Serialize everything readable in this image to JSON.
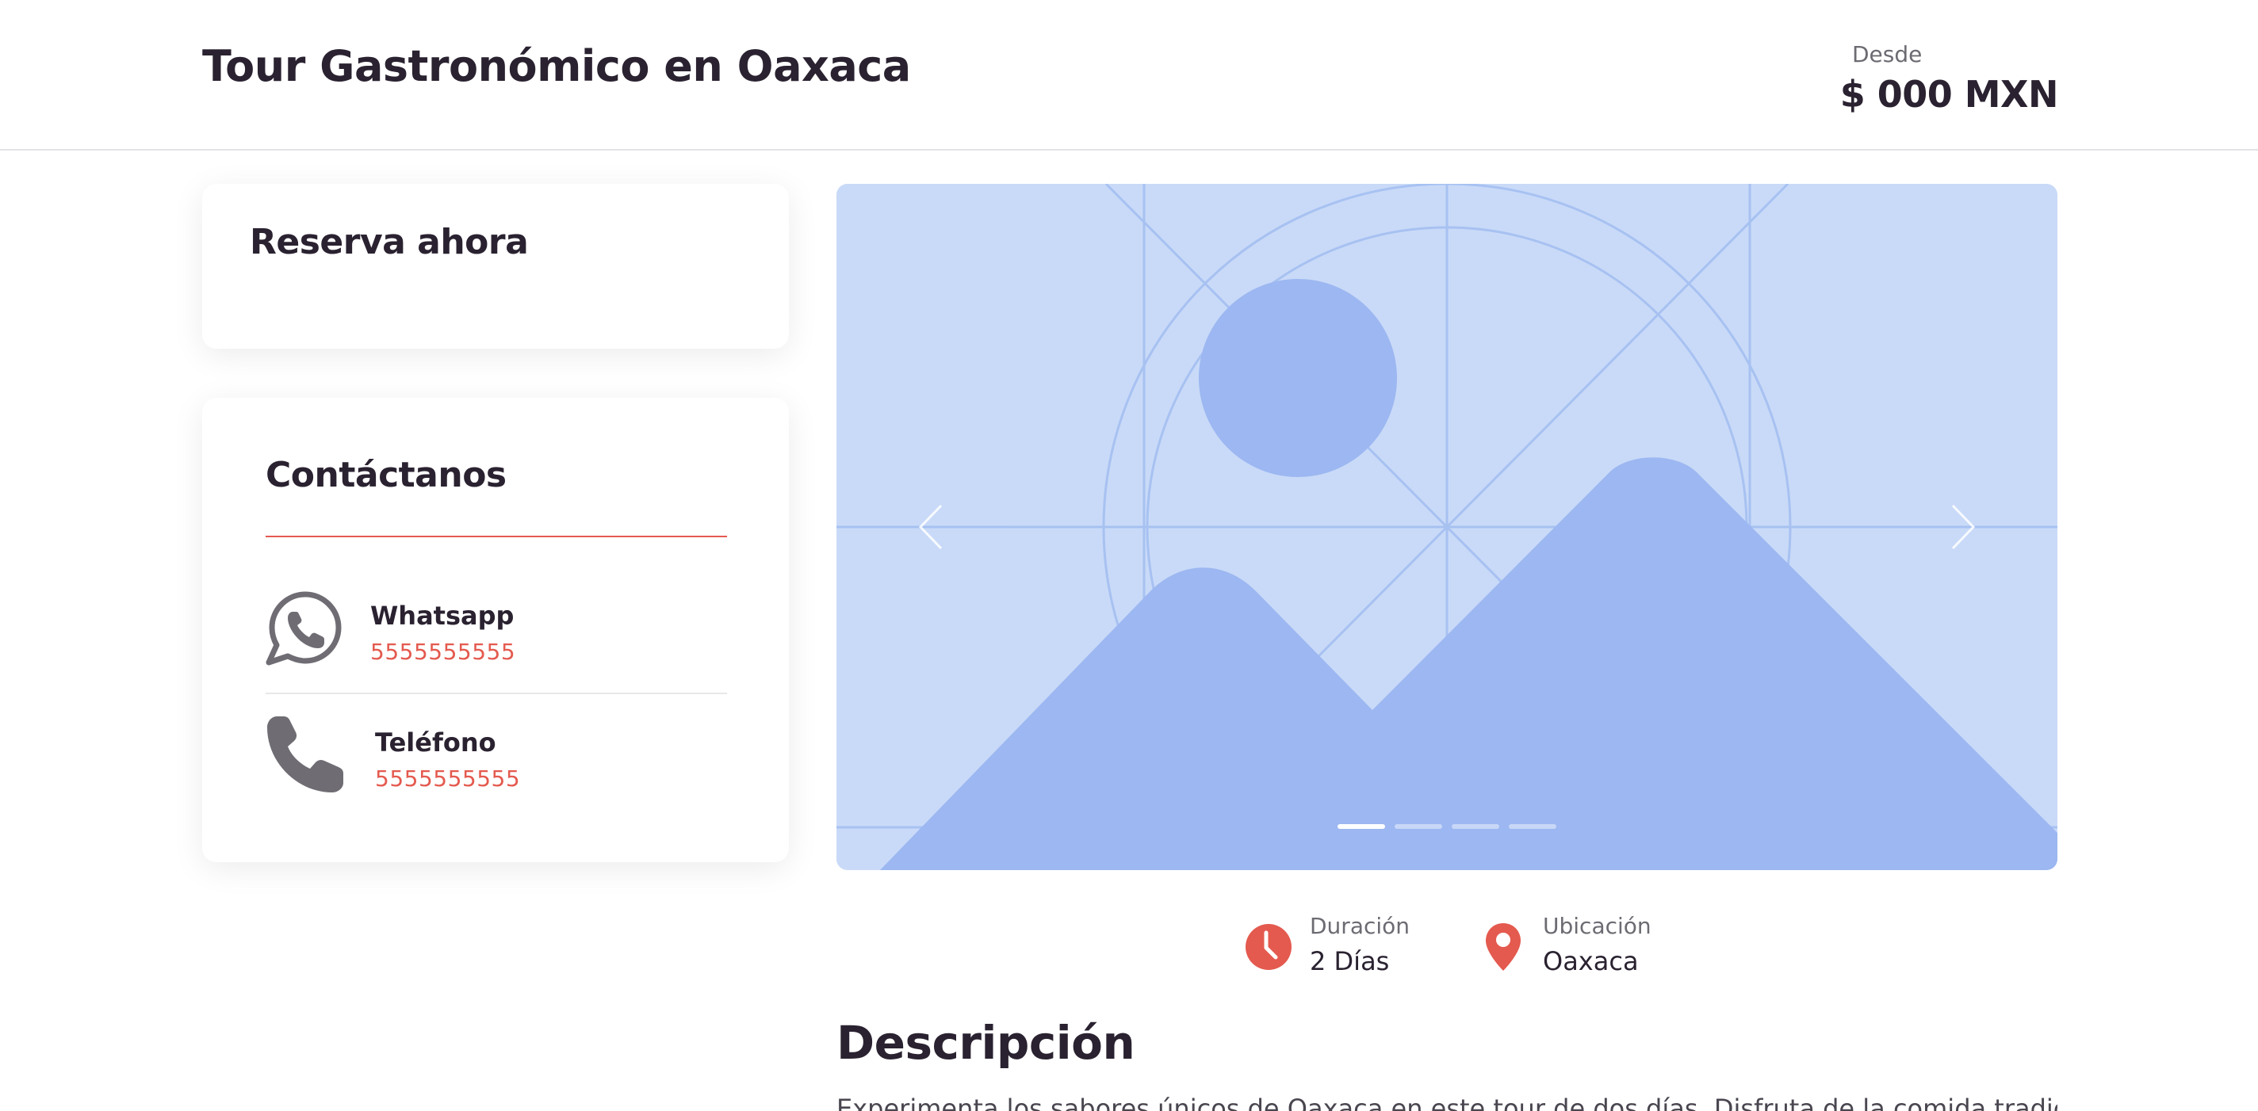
{
  "header": {
    "title": "Tour Gastronómico en Oaxaca",
    "price_label": "Desde",
    "price_value": "$ 000 MXN"
  },
  "reserve": {
    "title": "Reserva ahora"
  },
  "contact": {
    "title": "Contáctanos",
    "items": [
      {
        "name": "Whatsapp",
        "number": "5555555555",
        "icon": "whatsapp-icon"
      },
      {
        "name": "Teléfono",
        "number": "5555555555",
        "icon": "phone-icon"
      }
    ]
  },
  "carousel": {
    "image": "image-placeholder",
    "slide_count": 4,
    "active_slide": 1
  },
  "info": {
    "duration": {
      "label": "Duración",
      "value": "2 Días",
      "icon": "clock-icon"
    },
    "location": {
      "label": "Ubicación",
      "value": "Oaxaca",
      "icon": "map-pin-icon"
    }
  },
  "description": {
    "title": "Descripción",
    "text": "Experimenta los sabores únicos de Oaxaca en este tour de dos días. Disfruta de la comida tradicional"
  },
  "colors": {
    "accent": "#e45a4f",
    "text": "#2a2230",
    "muted": "#6d6b72",
    "placeholder_bg": "#c9daf8",
    "placeholder_fg": "#9cb7f1"
  }
}
